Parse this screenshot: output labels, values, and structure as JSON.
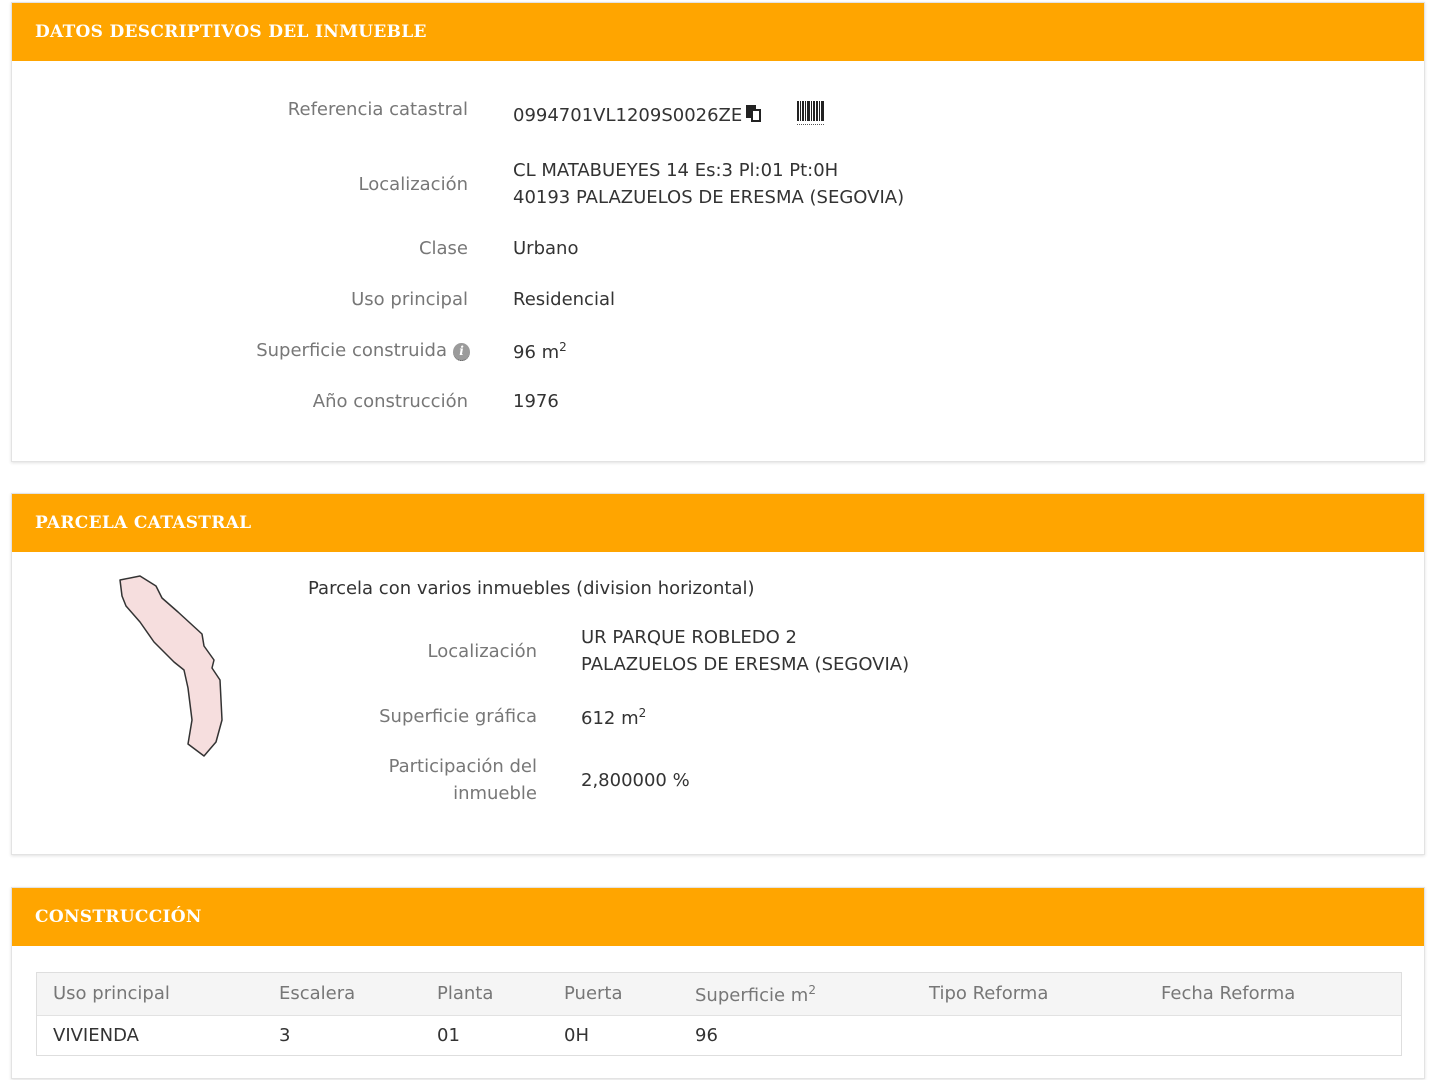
{
  "datos": {
    "header": "DATOS DESCRIPTIVOS DEL INMUEBLE",
    "referencia_label": "Referencia catastral",
    "referencia_value": "0994701VL1209S0026ZE",
    "localizacion_label": "Localización",
    "localizacion_line1": "CL MATABUEYES 14 Es:3 Pl:01 Pt:0H",
    "localizacion_line2": "40193 PALAZUELOS DE ERESMA (SEGOVIA)",
    "clase_label": "Clase",
    "clase_value": "Urbano",
    "uso_label": "Uso principal",
    "uso_value": "Residencial",
    "superficie_label": "Superficie construida",
    "superficie_value": "96 m",
    "superficie_sup": "2",
    "anio_label": "Año construcción",
    "anio_value": "1976",
    "info_glyph": "i"
  },
  "parcela": {
    "header": "PARCELA CATASTRAL",
    "descripcion": "Parcela con varios inmuebles (division horizontal)",
    "localizacion_label": "Localización",
    "localizacion_line1": "UR PARQUE ROBLEDO 2",
    "localizacion_line2": "PALAZUELOS DE ERESMA (SEGOVIA)",
    "superficie_label": "Superficie gráfica",
    "superficie_value": "612 m",
    "superficie_sup": "2",
    "participacion_label_line1": "Participación del",
    "participacion_label_line2": "inmueble",
    "participacion_value": "2,800000 %"
  },
  "construccion": {
    "header": "CONSTRUCCIÓN",
    "columns": [
      "Uso principal",
      "Escalera",
      "Planta",
      "Puerta",
      "Superficie m",
      "Tipo Reforma",
      "Fecha Reforma"
    ],
    "superficie_sup": "2",
    "rows": [
      [
        "VIVIENDA",
        "3",
        "01",
        "0H",
        "96",
        "",
        ""
      ]
    ]
  },
  "colors": {
    "header_bg": "#FFA500",
    "parcel_fill": "#F6DEDE"
  },
  "icons": [
    "copy-icon",
    "barcode-icon",
    "info-icon"
  ]
}
